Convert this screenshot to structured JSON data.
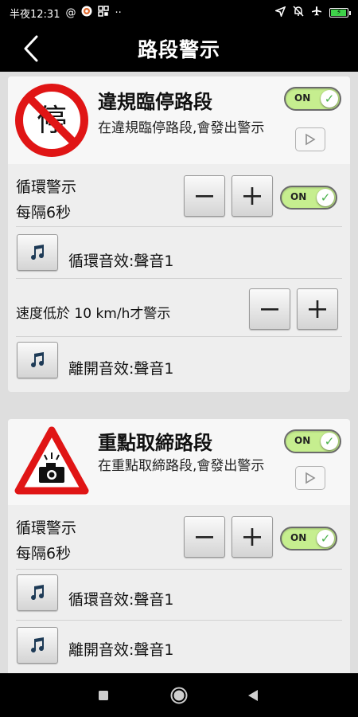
{
  "status_bar": {
    "time": "半夜12:31",
    "left_icons": [
      "at-sign-icon",
      "app-badge-icon",
      "qr-code-icon",
      "more-dots-icon"
    ],
    "right_icons": [
      "location-arrow-icon",
      "mute-icon",
      "airplane-mode-icon",
      "battery-charging-icon"
    ],
    "battery_level": 0.85
  },
  "header": {
    "title": "路段警示",
    "back_icon": "chevron-left-icon"
  },
  "toggle_on_label": "ON",
  "cards": [
    {
      "sign_icon": "no-stopping-sign-icon",
      "sign_char": "停",
      "title": "違規臨停路段",
      "description": "在違規臨停路段,會發出警示",
      "enabled": true,
      "loop": {
        "label": "循環警示",
        "interval": "每隔6秒",
        "enabled": true
      },
      "loop_sound": "循環音效:聲音1",
      "speed_rule": "速度低於 10 km/h才警示",
      "exit_sound": "離開音效:聲音1"
    },
    {
      "sign_icon": "speed-camera-warning-sign-icon",
      "title": "重點取締路段",
      "description": "在重點取締路段,會發出警示",
      "enabled": true,
      "loop": {
        "label": "循環警示",
        "interval": "每隔6秒",
        "enabled": true
      },
      "loop_sound": "循環音效:聲音1",
      "exit_sound": "離開音效:聲音1"
    }
  ],
  "nav_bar": {
    "icons": [
      "recents-square-icon",
      "home-circle-icon",
      "back-triangle-icon"
    ]
  }
}
